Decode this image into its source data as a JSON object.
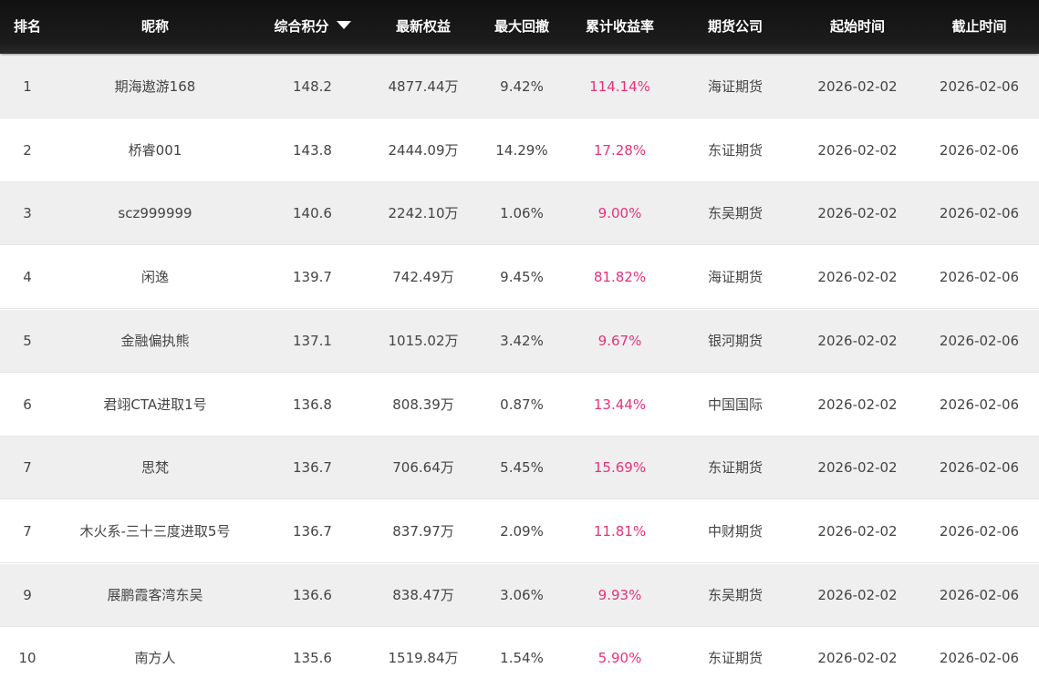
{
  "header": {
    "rank": "排名",
    "nickname": "昵称",
    "score": "综合积分",
    "equity": "最新权益",
    "max_drawdown": "最大回撤",
    "cum_return": "累计收益率",
    "company": "期货公司",
    "start_time": "起始时间",
    "end_time": "截止时间",
    "sort_icon": "caret-down-icon"
  },
  "colors": {
    "header_bg": "#1a1a1a",
    "header_text": "#ffffff",
    "row_alt_bg": "#efefef",
    "text": "#444444",
    "return_color": "#e8327a"
  },
  "rows": [
    {
      "rank": "1",
      "nickname": "期海遨游168",
      "score": "148.2",
      "equity": "4877.44万",
      "max_drawdown": "9.42%",
      "cum_return": "114.14%",
      "company": "海证期货",
      "start_time": "2026-02-02",
      "end_time": "2026-02-06"
    },
    {
      "rank": "2",
      "nickname": "桥睿001",
      "score": "143.8",
      "equity": "2444.09万",
      "max_drawdown": "14.29%",
      "cum_return": "17.28%",
      "company": "东证期货",
      "start_time": "2026-02-02",
      "end_time": "2026-02-06"
    },
    {
      "rank": "3",
      "nickname": "scz999999",
      "score": "140.6",
      "equity": "2242.10万",
      "max_drawdown": "1.06%",
      "cum_return": "9.00%",
      "company": "东吴期货",
      "start_time": "2026-02-02",
      "end_time": "2026-02-06"
    },
    {
      "rank": "4",
      "nickname": "闲逸",
      "score": "139.7",
      "equity": "742.49万",
      "max_drawdown": "9.45%",
      "cum_return": "81.82%",
      "company": "海证期货",
      "start_time": "2026-02-02",
      "end_time": "2026-02-06"
    },
    {
      "rank": "5",
      "nickname": "金融偏执熊",
      "score": "137.1",
      "equity": "1015.02万",
      "max_drawdown": "3.42%",
      "cum_return": "9.67%",
      "company": "银河期货",
      "start_time": "2026-02-02",
      "end_time": "2026-02-06"
    },
    {
      "rank": "6",
      "nickname": "君翊CTA进取1号",
      "score": "136.8",
      "equity": "808.39万",
      "max_drawdown": "0.87%",
      "cum_return": "13.44%",
      "company": "中国国际",
      "start_time": "2026-02-02",
      "end_time": "2026-02-06"
    },
    {
      "rank": "7",
      "nickname": "思梵",
      "score": "136.7",
      "equity": "706.64万",
      "max_drawdown": "5.45%",
      "cum_return": "15.69%",
      "company": "东证期货",
      "start_time": "2026-02-02",
      "end_time": "2026-02-06"
    },
    {
      "rank": "7",
      "nickname": "木火系-三十三度进取5号",
      "score": "136.7",
      "equity": "837.97万",
      "max_drawdown": "2.09%",
      "cum_return": "11.81%",
      "company": "中财期货",
      "start_time": "2026-02-02",
      "end_time": "2026-02-06"
    },
    {
      "rank": "9",
      "nickname": "展鹏霞客湾东吴",
      "score": "136.6",
      "equity": "838.47万",
      "max_drawdown": "3.06%",
      "cum_return": "9.93%",
      "company": "东吴期货",
      "start_time": "2026-02-02",
      "end_time": "2026-02-06"
    },
    {
      "rank": "10",
      "nickname": "南方人",
      "score": "135.6",
      "equity": "1519.84万",
      "max_drawdown": "1.54%",
      "cum_return": "5.90%",
      "company": "东证期货",
      "start_time": "2026-02-02",
      "end_time": "2026-02-06"
    }
  ]
}
